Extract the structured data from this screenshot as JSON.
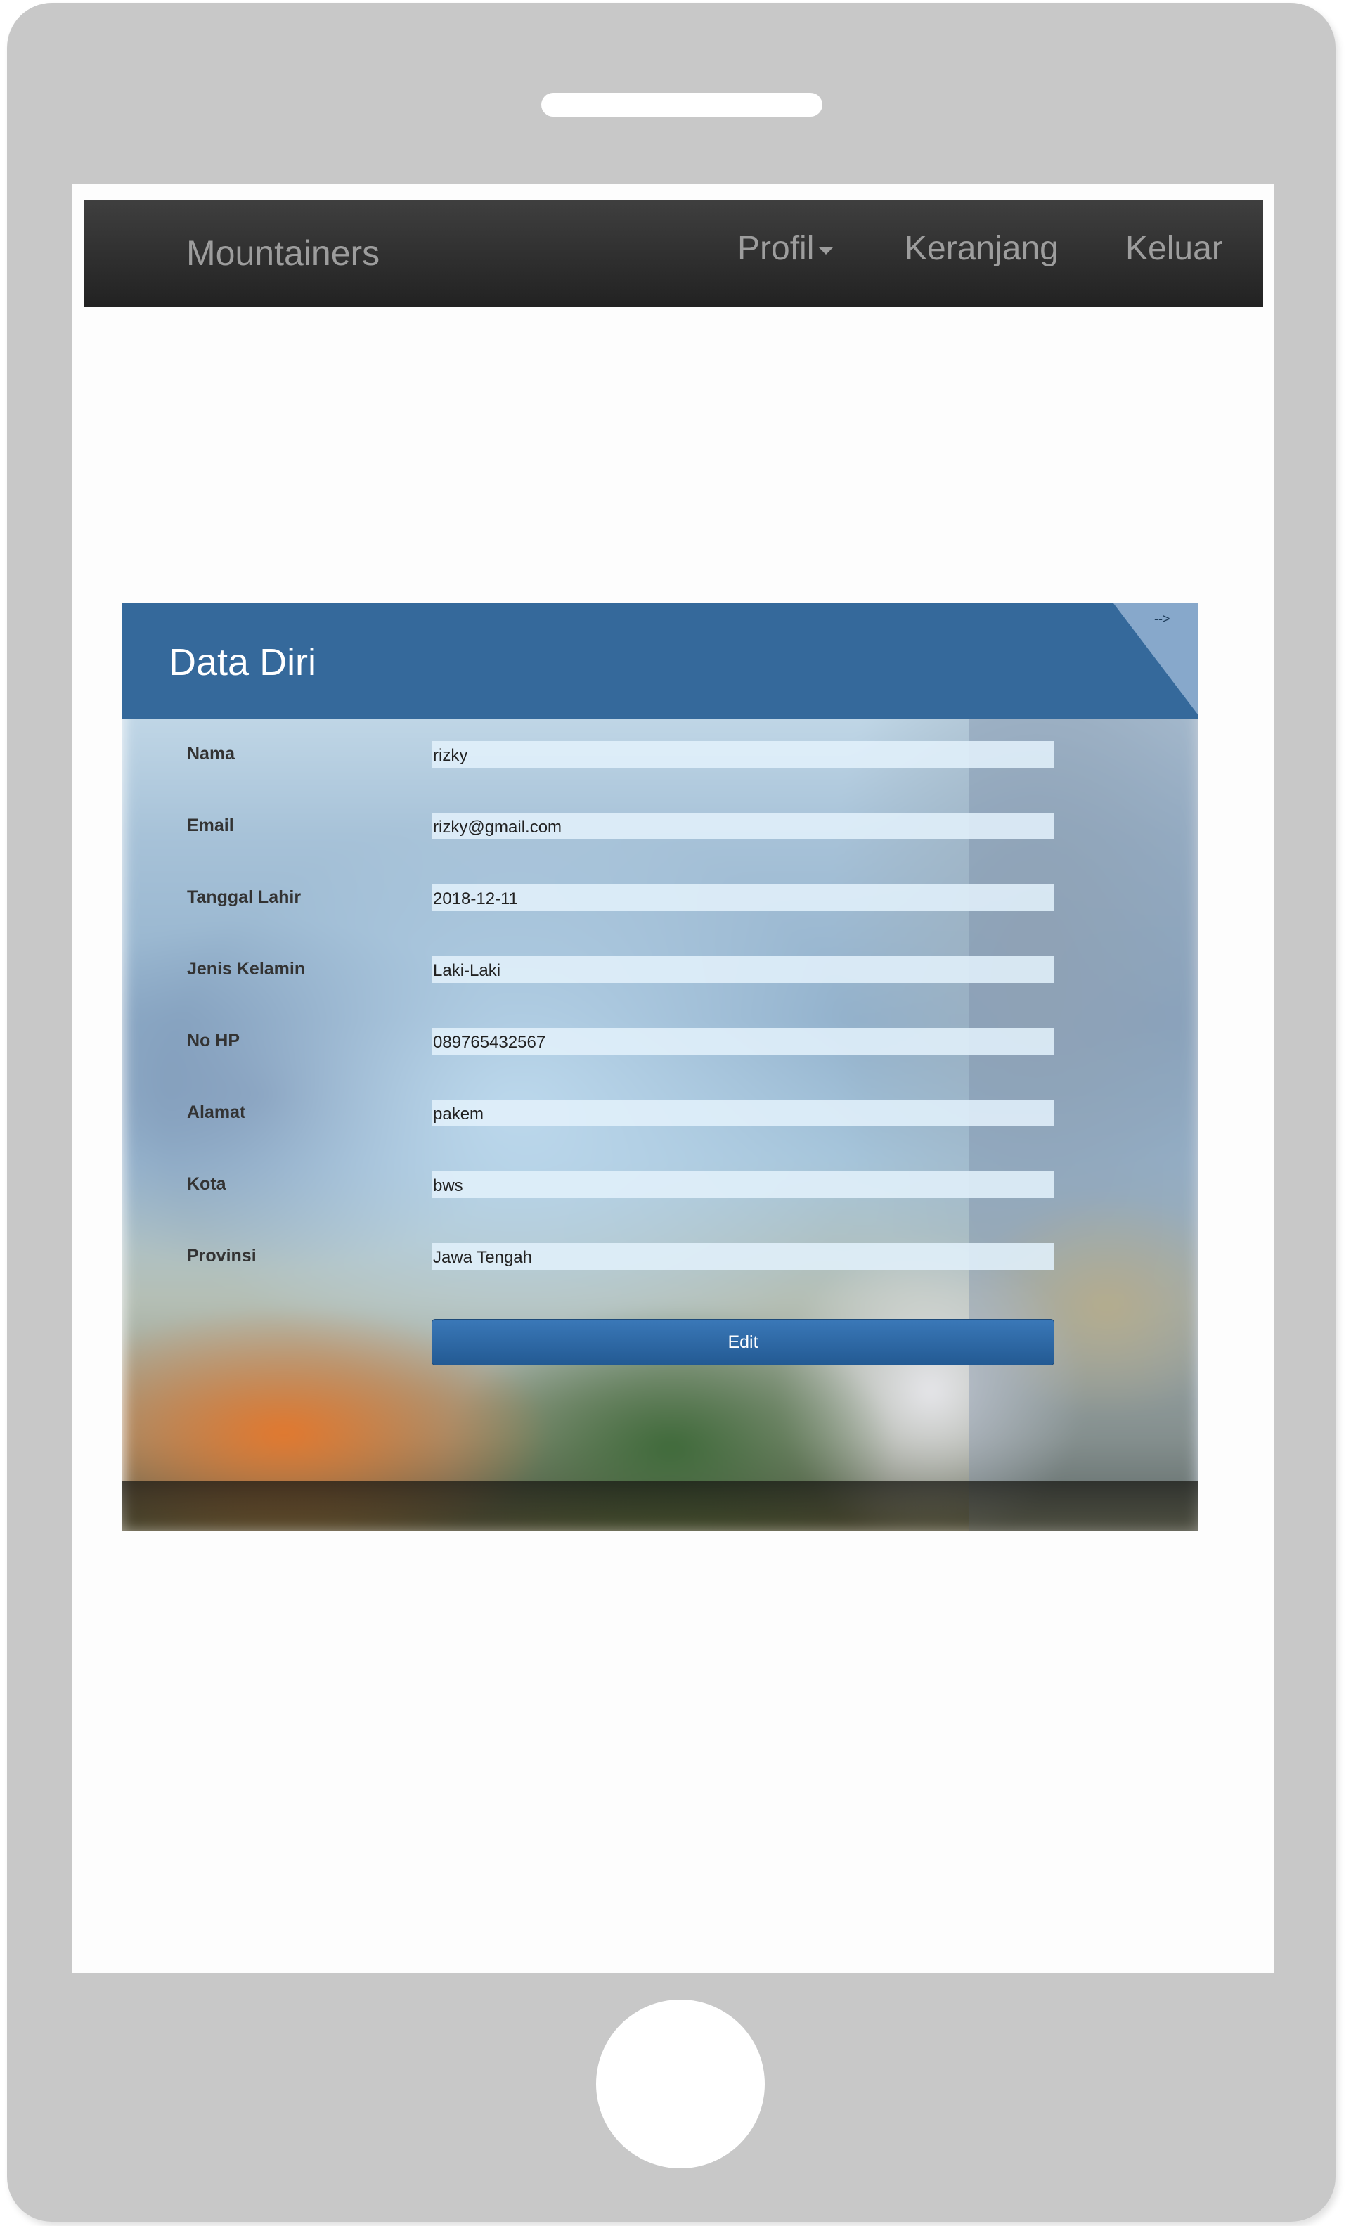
{
  "navbar": {
    "brand": "Mountainers",
    "items": [
      {
        "label": "Profil"
      },
      {
        "label": "Keranjang"
      },
      {
        "label": "Keluar"
      }
    ]
  },
  "card": {
    "title": "Data Diri",
    "corner_note": "-->",
    "fields": [
      {
        "label": "Nama",
        "value": "rizky"
      },
      {
        "label": "Email",
        "value": "rizky@gmail.com"
      },
      {
        "label": "Tanggal Lahir",
        "value": "2018-12-11"
      },
      {
        "label": "Jenis Kelamin",
        "value": "Laki-Laki"
      },
      {
        "label": "No HP",
        "value": "089765432567"
      },
      {
        "label": "Alamat",
        "value": "pakem"
      },
      {
        "label": "Kota",
        "value": "bws"
      },
      {
        "label": "Provinsi",
        "value": "Jawa Tengah"
      }
    ],
    "edit_label": "Edit"
  }
}
